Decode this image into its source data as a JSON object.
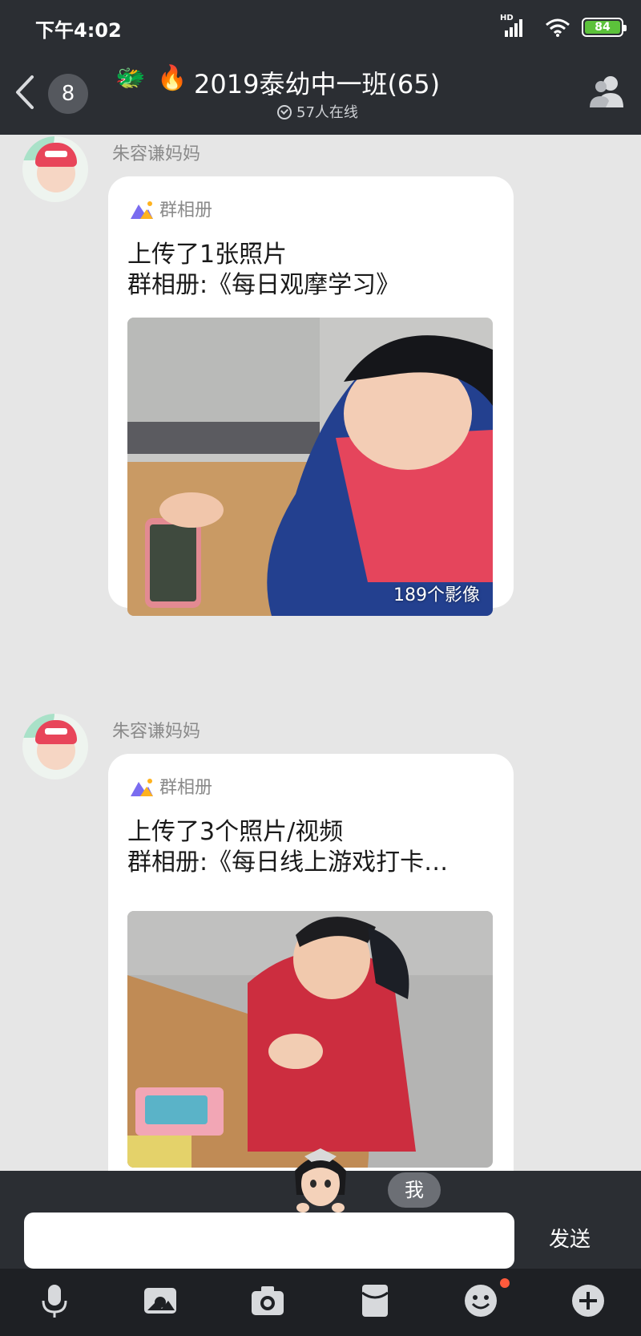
{
  "status_bar": {
    "time": "下午4:02",
    "network": "HD",
    "battery_level": "84",
    "battery_color": "#5cc23b"
  },
  "header": {
    "unread_count": "8",
    "emoji_1": "🐲",
    "emoji_2": "🔥",
    "title": "2019泰幼中一班(65)",
    "online_text": "57人在线"
  },
  "messages": [
    {
      "sender": "朱容谦妈妈",
      "album_label": "群相册",
      "line1": "上传了1张照片",
      "line2": "群相册:《每日观摩学习》",
      "photo_count": "189个影像"
    },
    {
      "sender": "朱容谦妈妈",
      "album_label": "群相册",
      "line1": "上传了3个照片/视频",
      "line2": "群相册:《每日线上游戏打卡…"
    }
  ],
  "input": {
    "placeholder": "",
    "send_label": "发送",
    "me_label": "我"
  },
  "toolbar": {
    "items": [
      "mic-icon",
      "gallery-icon",
      "camera-icon",
      "red-packet-icon",
      "emoji-icon",
      "plus-icon"
    ]
  },
  "colors": {
    "header_bg": "#2b2e33",
    "chat_bg": "#e6e6e6",
    "toolbar_bg": "#1e2024",
    "notification_dot": "#ff5a3c"
  }
}
